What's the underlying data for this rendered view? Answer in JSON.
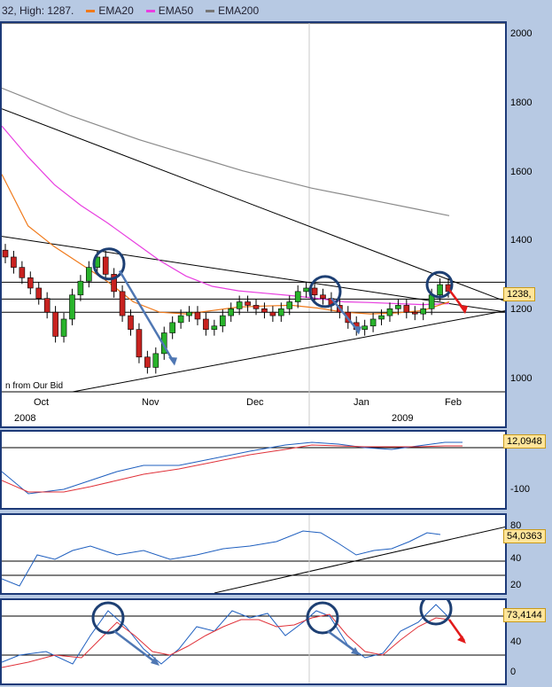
{
  "legend": {
    "price_text": "32, High: 1287.",
    "items": [
      {
        "name": "EMA20",
        "color": "#f07a1b"
      },
      {
        "name": "EMA50",
        "color": "#e83ee0"
      },
      {
        "name": "EMA200",
        "color": "#777777"
      }
    ]
  },
  "main_note": "n from Our Bid",
  "price_badge": "1238,",
  "x_axis": {
    "months": [
      "Oct",
      "Nov",
      "Dec",
      "Jan",
      "Feb"
    ],
    "years": [
      "2008",
      "2009"
    ]
  },
  "panel2": {
    "badge": "12,0948",
    "ticks": [
      "-100"
    ]
  },
  "panel3": {
    "badge": "54,0363",
    "ticks": [
      "80",
      "40",
      "20"
    ]
  },
  "panel4": {
    "badge": "73,4144",
    "ticks": [
      "80",
      "40",
      "0"
    ]
  },
  "chart_data": {
    "type": "line",
    "title": "",
    "y_ticks": [
      1000,
      1200,
      1400,
      1600,
      1800,
      2000
    ],
    "ylim": [
      960,
      2060
    ],
    "horizontal_levels": [
      1200,
      1238,
      1287
    ],
    "ema200": [
      1850,
      1810,
      1770,
      1735,
      1700,
      1670,
      1640,
      1610,
      1585,
      1560,
      1540,
      1520,
      1500,
      1480
    ],
    "ema50": [
      1740,
      1650,
      1570,
      1510,
      1460,
      1405,
      1350,
      1305,
      1275,
      1262,
      1255,
      1248,
      1240,
      1230,
      1228,
      1225,
      1222,
      1225
    ],
    "ema20": [
      1600,
      1450,
      1390,
      1340,
      1290,
      1230,
      1200,
      1195,
      1205,
      1215,
      1218,
      1220,
      1212,
      1200,
      1195,
      1198,
      1205,
      1230
    ],
    "closes": [
      1360,
      1330,
      1300,
      1270,
      1240,
      1200,
      1130,
      1180,
      1250,
      1290,
      1330,
      1360,
      1310,
      1260,
      1190,
      1150,
      1070,
      1040,
      1080,
      1140,
      1170,
      1190,
      1200,
      1180,
      1150,
      1160,
      1190,
      1210,
      1230,
      1220,
      1210,
      1200,
      1190,
      1210,
      1230,
      1260,
      1270,
      1250,
      1240,
      1220,
      1200,
      1170,
      1150,
      1160,
      1180,
      1190,
      1210,
      1220,
      1200,
      1195,
      1210,
      1250,
      1280,
      1260
    ]
  }
}
